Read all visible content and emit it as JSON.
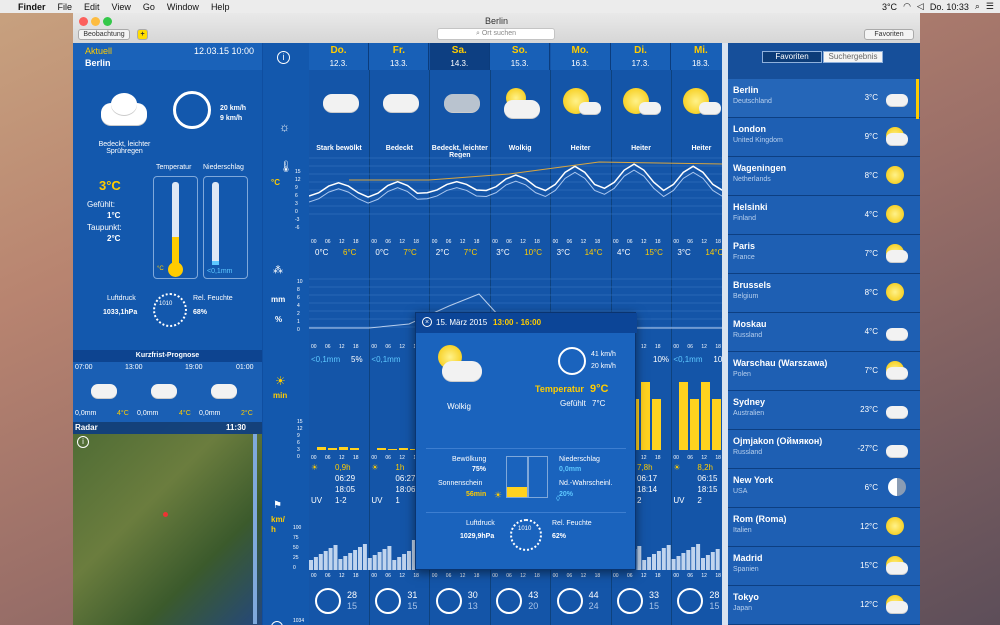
{
  "menubar": {
    "apple": "",
    "finder": "Finder",
    "items": [
      "File",
      "Edit",
      "View",
      "Go",
      "Window",
      "Help"
    ],
    "temp": "3°C",
    "clock": "Do. 10:33"
  },
  "window": {
    "title": "Berlin",
    "beobachtung": "Beobachtung",
    "add": "+",
    "search_placeholder": "Ort suchen",
    "favoriten": "Favoriten"
  },
  "current": {
    "label": "Aktuell",
    "date": "12.03.15 10:00",
    "city": "Berlin",
    "wind1": "20 km/h",
    "wind2": "9 km/h",
    "condition": "Bedeckt, leichter Sprühregen",
    "temp": "3°C",
    "temp_label": "Temperatur",
    "precip_label": "Niederschlag",
    "felt_label": "Gefühlt:",
    "felt": "1°C",
    "dew_label": "Taupunkt:",
    "dew": "2°C",
    "c_unit": "°C",
    "precip_val": "<0,1mm",
    "pressure_label": "Luftdruck",
    "pressure": "1033,1hPa",
    "gauge": "1010",
    "humidity_label": "Rel. Feuchte",
    "humidity": "68%",
    "thermo_ticks": [
      "50",
      "40",
      "30",
      "20",
      "10",
      "0",
      "-10",
      "-20"
    ],
    "rain_ticks": [
      "10",
      "8",
      "6",
      "4",
      "2",
      "1",
      "0"
    ]
  },
  "short": {
    "title": "Kurzfrist-Prognose",
    "times": [
      "07:00",
      "13:00",
      "19:00",
      "01:00"
    ],
    "precip": [
      "0,0mm",
      "0,0mm",
      "0,0mm"
    ],
    "temps": [
      "4°C",
      "4°C",
      "2°C"
    ]
  },
  "radar": {
    "label": "Radar",
    "time": "11:30"
  },
  "days": [
    {
      "d": "Do.",
      "date": "12.3.",
      "cond": "Stark bewölkt",
      "min": "0°C",
      "max": "6°C",
      "rain": "<0,1mm",
      "pct": "5%",
      "sun": "0,9h",
      "rise": "06:29",
      "set": "18:05",
      "uv": "1-2",
      "w1": "28",
      "w2": "15"
    },
    {
      "d": "Fr.",
      "date": "13.3.",
      "cond": "Bedeckt",
      "min": "0°C",
      "max": "7°C",
      "rain": "<0,1mm",
      "pct": "",
      "sun": "1h",
      "rise": "06:27",
      "set": "18:06",
      "uv": "1",
      "w1": "31",
      "w2": "15"
    },
    {
      "d": "Sa.",
      "date": "14.3.",
      "cond": "Bedeckt, leichter Regen",
      "min": "2°C",
      "max": "7°C",
      "rain": "",
      "pct": "",
      "sun": "",
      "rise": "",
      "set": "",
      "uv": "",
      "w1": "30",
      "w2": "13"
    },
    {
      "d": "So.",
      "date": "15.3.",
      "cond": "Wolkig",
      "min": "3°C",
      "max": "10°C",
      "rain": "",
      "pct": "",
      "sun": "",
      "rise": "",
      "set": "",
      "uv": "",
      "w1": "43",
      "w2": "20"
    },
    {
      "d": "Mo.",
      "date": "16.3.",
      "cond": "Heiter",
      "min": "3°C",
      "max": "14°C",
      "rain": "",
      "pct": "",
      "sun": "",
      "rise": "",
      "set": "",
      "uv": "",
      "w1": "44",
      "w2": "24"
    },
    {
      "d": "Di.",
      "date": "17.3.",
      "cond": "Heiter",
      "min": "4°C",
      "max": "15°C",
      "rain": "",
      "pct": "10%",
      "sun": "7,8h",
      "rise": "06:17",
      "set": "18:14",
      "uv": "2",
      "w1": "33",
      "w2": "15"
    },
    {
      "d": "Mi.",
      "date": "18.3.",
      "cond": "Heiter",
      "min": "3°C",
      "max": "14°C",
      "rain": "<0,1mm",
      "pct": "10%",
      "sun": "8,2h",
      "rise": "06:15",
      "set": "18:15",
      "uv": "2",
      "w1": "28",
      "w2": "15"
    }
  ],
  "axis": {
    "c": "°C",
    "mm": "mm",
    "pct": "%",
    "min": "min",
    "kmh": "km/\nh",
    "ticks_t": [
      "15",
      "12",
      "9",
      "6",
      "3",
      "0",
      "-3",
      "-6"
    ],
    "ticks_r": [
      "10",
      "8",
      "6",
      "4",
      "2",
      "1",
      "0"
    ],
    "ticks_s": [
      "15",
      "12",
      "9",
      "6",
      "3",
      "0"
    ],
    "ticks_w": [
      "100",
      "75",
      "50",
      "25",
      "0"
    ],
    "hours": [
      "00",
      "06",
      "12",
      "18"
    ],
    "bottom": "1034"
  },
  "overlay": {
    "date": "15. März 2015",
    "time": "13:00 - 16:00",
    "cond": "Wolkig",
    "wind1": "41 km/h",
    "wind2": "20 km/h",
    "temp_label": "Temperatur",
    "temp": "9°C",
    "felt_label": "Gefühlt",
    "felt": "7°C",
    "cloud_label": "Bewölkung",
    "cloud": "75%",
    "sun_label": "Sonnenschein",
    "sun": "56min",
    "rain_label": "Niederschlag",
    "rain": "0,0mm",
    "prob_label": "Nd.-Wahrscheinl.",
    "prob": "20%",
    "pressure_label": "Luftdruck",
    "pressure": "1029,9hPa",
    "gauge": "1010",
    "humidity_label": "Rel. Feuchte",
    "humidity": "62%"
  },
  "favorites": {
    "tab_fav": "Favoriten",
    "tab_search": "Suchergebnis",
    "items": [
      {
        "name": "Berlin",
        "country": "Deutschland",
        "temp": "3°C",
        "icon": "rain-cloud-icon"
      },
      {
        "name": "London",
        "country": "United Kingdom",
        "temp": "9°C",
        "icon": "sun-cloud-icon"
      },
      {
        "name": "Wageningen",
        "country": "Netherlands",
        "temp": "8°C",
        "icon": "sun-icon"
      },
      {
        "name": "Helsinki",
        "country": "Finland",
        "temp": "4°C",
        "icon": "sun-icon"
      },
      {
        "name": "Paris",
        "country": "France",
        "temp": "7°C",
        "icon": "sun-cloud-icon"
      },
      {
        "name": "Brussels",
        "country": "Belgium",
        "temp": "8°C",
        "icon": "sun-icon"
      },
      {
        "name": "Moskau",
        "country": "Russland",
        "temp": "4°C",
        "icon": "cloud-icon"
      },
      {
        "name": "Warschau (Warszawa)",
        "country": "Polen",
        "temp": "7°C",
        "icon": "sun-cloud-icon"
      },
      {
        "name": "Sydney",
        "country": "Australien",
        "temp": "23°C",
        "icon": "cloud-icon"
      },
      {
        "name": "Ojmjakon (Оймякон)",
        "country": "Russland",
        "temp": "-27°C",
        "icon": "moon-cloud-icon"
      },
      {
        "name": "New York",
        "country": "USA",
        "temp": "6°C",
        "icon": "moon-icon"
      },
      {
        "name": "Rom (Roma)",
        "country": "Italien",
        "temp": "12°C",
        "icon": "sun-icon"
      },
      {
        "name": "Madrid",
        "country": "Spanien",
        "temp": "15°C",
        "icon": "sun-cloud-icon"
      },
      {
        "name": "Tokyo",
        "country": "Japan",
        "temp": "12°C",
        "icon": "sun-cloud-icon"
      }
    ]
  },
  "colors": {
    "bg": "#1455a8",
    "accent": "#ffcc00",
    "light": "#5ec8ff"
  }
}
